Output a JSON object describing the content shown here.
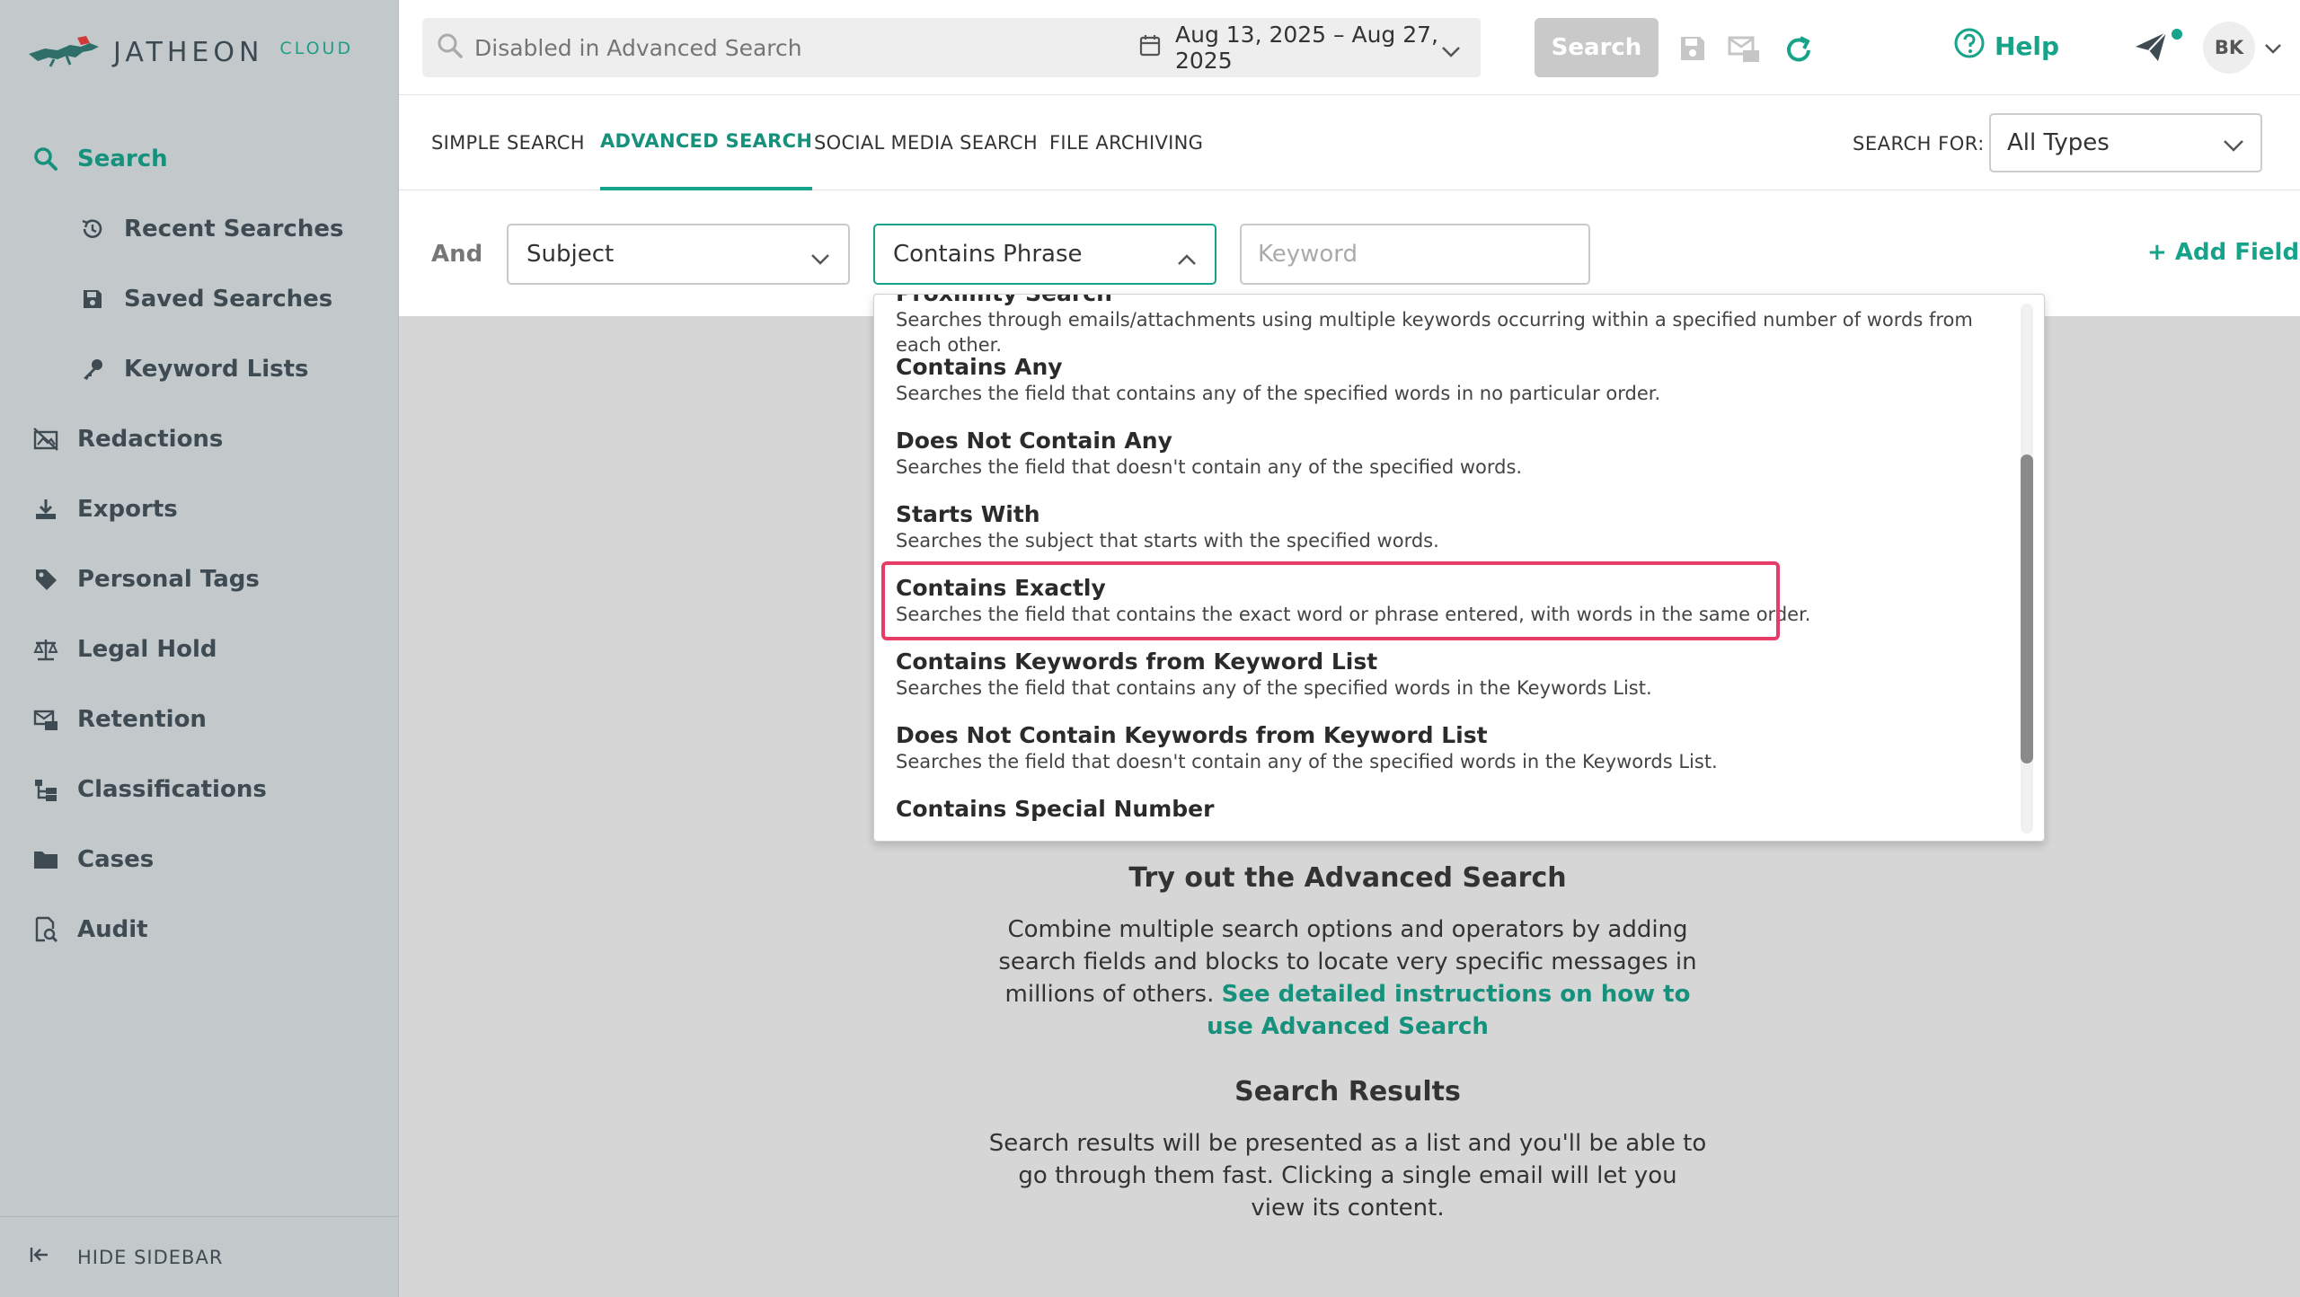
{
  "brand": {
    "name": "JATHEON",
    "suffix": "CLOUD"
  },
  "sidebar": {
    "items": [
      {
        "label": "Search",
        "icon": "search-icon",
        "active": true
      },
      {
        "label": "Recent Searches",
        "icon": "history-icon",
        "sub": true
      },
      {
        "label": "Saved Searches",
        "icon": "save-icon",
        "sub": true
      },
      {
        "label": "Keyword Lists",
        "icon": "key-icon",
        "sub": true
      },
      {
        "label": "Redactions",
        "icon": "redaction-icon"
      },
      {
        "label": "Exports",
        "icon": "download-icon"
      },
      {
        "label": "Personal Tags",
        "icon": "tag-icon"
      },
      {
        "label": "Legal Hold",
        "icon": "scales-icon"
      },
      {
        "label": "Retention",
        "icon": "retention-icon"
      },
      {
        "label": "Classifications",
        "icon": "hierarchy-icon"
      },
      {
        "label": "Cases",
        "icon": "folder-icon"
      },
      {
        "label": "Audit",
        "icon": "audit-icon"
      }
    ],
    "hide_label": "HIDE SIDEBAR"
  },
  "topbar": {
    "search_placeholder": "Disabled in Advanced Search",
    "date_range": "Aug 13, 2025 – Aug 27, 2025",
    "search_button": "Search",
    "help_label": "Help",
    "avatar_initials": "BK"
  },
  "tabs": {
    "items": [
      "SIMPLE SEARCH",
      "ADVANCED SEARCH",
      "SOCIAL MEDIA SEARCH",
      "FILE ARCHIVING"
    ],
    "active": "ADVANCED SEARCH",
    "search_for_label": "SEARCH FOR:",
    "search_for_value": "All Types"
  },
  "criteria": {
    "operator": "And",
    "field": "Subject",
    "condition": "Contains Phrase",
    "keyword_placeholder": "Keyword",
    "add_field": "+ Add Field"
  },
  "dropdown": {
    "options": [
      {
        "title": "Proximity Search",
        "desc": "Searches through emails/attachments using multiple keywords occurring within a specified number of words from each other."
      },
      {
        "title": "Contains Any",
        "desc": "Searches the field that contains any of the specified words in no particular order."
      },
      {
        "title": "Does Not Contain Any",
        "desc": "Searches the field that doesn't contain any of the specified words."
      },
      {
        "title": "Starts With",
        "desc": "Searches the subject that starts with the specified words."
      },
      {
        "title": "Contains Exactly",
        "desc": "Searches the field that contains the exact word or phrase entered, with words in the same order."
      },
      {
        "title": "Contains Keywords from Keyword List",
        "desc": "Searches the field that contains any of the specified words in the Keywords List."
      },
      {
        "title": "Does Not Contain Keywords from Keyword List",
        "desc": "Searches the field that doesn't contain any of the specified words in the Keywords List."
      },
      {
        "title": "Contains Special Number",
        "desc": ""
      }
    ],
    "highlighted": "Contains Exactly"
  },
  "info": {
    "try_title": "Try out the Advanced Search",
    "try_text": "Combine multiple search options and operators by adding search fields and blocks to locate very specific messages in millions of others.",
    "try_link": "See detailed instructions on how to use Advanced Search",
    "results_title": "Search Results",
    "results_text": "Search results will be presented as a list and you'll be able to go through them fast. Clicking a single email will let you view its content."
  },
  "colors": {
    "accent": "#15a38a",
    "highlight": "#e63c66",
    "sidebar_bg": "#c3c8cb"
  }
}
